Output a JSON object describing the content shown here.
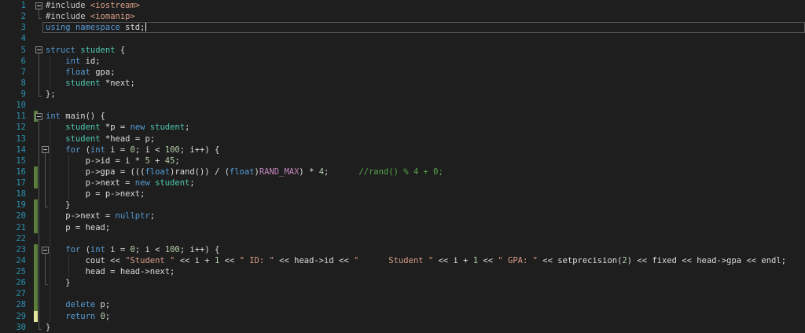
{
  "editor": {
    "colors": {
      "background": "#1E1E1E",
      "text": "#DCDCDC",
      "keyword": "#569CD6",
      "type": "#4EC9B0",
      "string": "#D69D85",
      "number": "#B5CEA8",
      "comment": "#57A64A",
      "macro": "#C586C0",
      "preprocessor": "#C8C8C8",
      "lineNumber": "#2B91AF",
      "changeSaved": "#5B7E3B",
      "changeUnsaved": "#E5E5A0",
      "activeLineBorder": "#555555",
      "foldBorder": "#858585",
      "foldGlyph": "#C8C8C8",
      "regionLine": "#555555",
      "indentGuide": "#4A4A4A",
      "caret": "#F0F0F0"
    },
    "lines": [
      {
        "num": "1",
        "fold": "outer",
        "tokens": [
          [
            "p",
            "#include "
          ],
          [
            "s",
            "<iostream>"
          ]
        ]
      },
      {
        "num": "2",
        "tokens": [
          [
            "p",
            "#include "
          ],
          [
            "s",
            "<iomanip>"
          ]
        ]
      },
      {
        "num": "3",
        "active": true,
        "cursor": true,
        "tokens": [
          [
            "k",
            "using"
          ],
          [
            "d",
            " "
          ],
          [
            "k",
            "namespace"
          ],
          [
            "d",
            " std;"
          ]
        ]
      },
      {
        "num": "4",
        "tokens": []
      },
      {
        "num": "5",
        "fold": "outer",
        "tokens": [
          [
            "k",
            "struct"
          ],
          [
            "d",
            " "
          ],
          [
            "t",
            "student"
          ],
          [
            "d",
            " {"
          ]
        ]
      },
      {
        "num": "6",
        "tokens": [
          [
            "d",
            "    "
          ],
          [
            "k",
            "int"
          ],
          [
            "d",
            " id;"
          ]
        ]
      },
      {
        "num": "7",
        "tokens": [
          [
            "d",
            "    "
          ],
          [
            "k",
            "float"
          ],
          [
            "d",
            " gpa;"
          ]
        ]
      },
      {
        "num": "8",
        "tokens": [
          [
            "d",
            "    "
          ],
          [
            "t",
            "student"
          ],
          [
            "d",
            " *next;"
          ]
        ]
      },
      {
        "num": "9",
        "tokens": [
          [
            "d",
            "};"
          ]
        ]
      },
      {
        "num": "10",
        "tokens": []
      },
      {
        "num": "11",
        "fold": "outer",
        "bar": "g",
        "tokens": [
          [
            "k",
            "int"
          ],
          [
            "d",
            " main() {"
          ]
        ]
      },
      {
        "num": "12",
        "tokens": [
          [
            "d",
            "    "
          ],
          [
            "t",
            "student"
          ],
          [
            "d",
            " *p = "
          ],
          [
            "k",
            "new"
          ],
          [
            "d",
            " "
          ],
          [
            "t",
            "student"
          ],
          [
            "d",
            ";"
          ]
        ]
      },
      {
        "num": "13",
        "tokens": [
          [
            "d",
            "    "
          ],
          [
            "t",
            "student"
          ],
          [
            "d",
            " *head = p;"
          ]
        ]
      },
      {
        "num": "14",
        "fold": "nested",
        "tokens": [
          [
            "d",
            "    "
          ],
          [
            "k",
            "for"
          ],
          [
            "d",
            " ("
          ],
          [
            "k",
            "int"
          ],
          [
            "d",
            " i = "
          ],
          [
            "n",
            "0"
          ],
          [
            "d",
            "; i < "
          ],
          [
            "n",
            "100"
          ],
          [
            "d",
            "; i++) {"
          ]
        ]
      },
      {
        "num": "15",
        "tokens": [
          [
            "d",
            "        p->id = i * "
          ],
          [
            "n",
            "5"
          ],
          [
            "d",
            " + "
          ],
          [
            "n",
            "45"
          ],
          [
            "d",
            ";"
          ]
        ]
      },
      {
        "num": "16",
        "bar": "g",
        "tokens": [
          [
            "d",
            "        p->gpa = ((("
          ],
          [
            "k",
            "float"
          ],
          [
            "d",
            ")rand()) / ("
          ],
          [
            "k",
            "float"
          ],
          [
            "d",
            ")"
          ],
          [
            "m",
            "RAND_MAX"
          ],
          [
            "d",
            ") * "
          ],
          [
            "n",
            "4"
          ],
          [
            "d",
            ";      "
          ],
          [
            "c",
            "//rand() % 4 + 0;"
          ]
        ]
      },
      {
        "num": "17",
        "bar": "g",
        "tokens": [
          [
            "d",
            "        p->next = "
          ],
          [
            "k",
            "new"
          ],
          [
            "d",
            " "
          ],
          [
            "t",
            "student"
          ],
          [
            "d",
            ";"
          ]
        ]
      },
      {
        "num": "18",
        "tokens": [
          [
            "d",
            "        p = p->next;"
          ]
        ]
      },
      {
        "num": "19",
        "bar": "g",
        "tokens": [
          [
            "d",
            "    }"
          ]
        ]
      },
      {
        "num": "20",
        "bar": "g",
        "tokens": [
          [
            "d",
            "    p->next = "
          ],
          [
            "k",
            "nullptr"
          ],
          [
            "d",
            ";"
          ]
        ]
      },
      {
        "num": "21",
        "bar": "g",
        "tokens": [
          [
            "d",
            "    p = head;"
          ]
        ]
      },
      {
        "num": "22",
        "tokens": []
      },
      {
        "num": "23",
        "fold": "nested",
        "bar": "g",
        "tokens": [
          [
            "d",
            "    "
          ],
          [
            "k",
            "for"
          ],
          [
            "d",
            " ("
          ],
          [
            "k",
            "int"
          ],
          [
            "d",
            " i = "
          ],
          [
            "n",
            "0"
          ],
          [
            "d",
            "; i < "
          ],
          [
            "n",
            "100"
          ],
          [
            "d",
            "; i++) {"
          ]
        ]
      },
      {
        "num": "24",
        "bar": "g",
        "tokens": [
          [
            "d",
            "        cout << "
          ],
          [
            "s",
            "\"Student \""
          ],
          [
            "d",
            " << i + "
          ],
          [
            "n",
            "1"
          ],
          [
            "d",
            " << "
          ],
          [
            "s",
            "\" ID: \""
          ],
          [
            "d",
            " << head->id << "
          ],
          [
            "s",
            "\"      Student \""
          ],
          [
            "d",
            " << i + "
          ],
          [
            "n",
            "1"
          ],
          [
            "d",
            " << "
          ],
          [
            "s",
            "\" GPA: \""
          ],
          [
            "d",
            " << setprecision("
          ],
          [
            "n",
            "2"
          ],
          [
            "d",
            ") << fixed << head->gpa << endl;"
          ]
        ]
      },
      {
        "num": "25",
        "bar": "g",
        "tokens": [
          [
            "d",
            "        head = head->next;"
          ]
        ]
      },
      {
        "num": "26",
        "bar": "g",
        "tokens": [
          [
            "d",
            "    }"
          ]
        ]
      },
      {
        "num": "27",
        "bar": "g",
        "tokens": []
      },
      {
        "num": "28",
        "bar": "g",
        "tokens": [
          [
            "d",
            "    "
          ],
          [
            "k",
            "delete"
          ],
          [
            "d",
            " p;"
          ]
        ]
      },
      {
        "num": "29",
        "bar": "y",
        "tokens": [
          [
            "d",
            "    "
          ],
          [
            "k",
            "return"
          ],
          [
            "d",
            " "
          ],
          [
            "n",
            "0"
          ],
          [
            "d",
            ";"
          ]
        ]
      },
      {
        "num": "30",
        "tokens": [
          [
            "d",
            "}"
          ]
        ]
      }
    ],
    "fold_regions": [
      {
        "from": 1,
        "to": 2,
        "level": "outer"
      },
      {
        "from": 5,
        "to": 9,
        "level": "outer"
      },
      {
        "from": 11,
        "to": 30,
        "level": "outer"
      },
      {
        "from": 14,
        "to": 19,
        "level": "nested"
      },
      {
        "from": 23,
        "to": 26,
        "level": "nested"
      }
    ],
    "indent_guides": [
      {
        "x": 63,
        "from": 6,
        "to": 8
      },
      {
        "x": 63,
        "from": 12,
        "to": 29
      },
      {
        "x": 87,
        "from": 15,
        "to": 18
      },
      {
        "x": 87,
        "from": 24,
        "to": 25
      }
    ]
  }
}
